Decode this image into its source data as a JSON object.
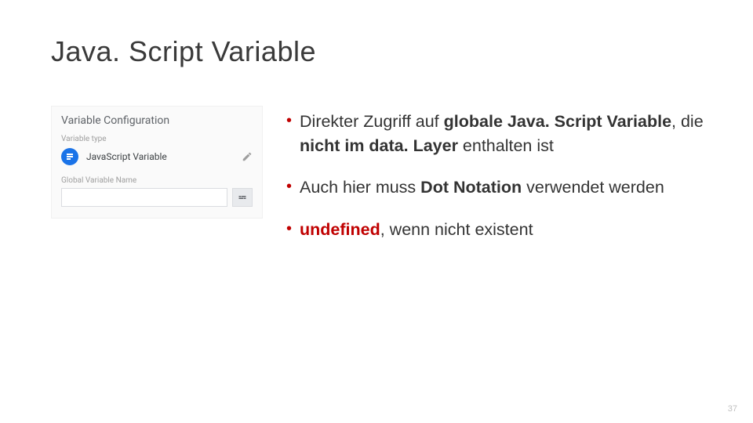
{
  "title": "Java. Script Variable",
  "panel": {
    "heading": "Variable Configuration",
    "sublabel": "Variable type",
    "type_name": "JavaScript Variable",
    "field_label": "Global Variable Name",
    "input_value": "",
    "input_placeholder": ""
  },
  "bullets": [
    {
      "segments": [
        {
          "t": "Direkter Zugriff auf "
        },
        {
          "t": "globale Java. Script Variable",
          "b": true
        },
        {
          "t": ", die "
        },
        {
          "t": "nicht im data. Layer",
          "b": true
        },
        {
          "t": " enthalten ist"
        }
      ]
    },
    {
      "segments": [
        {
          "t": "Auch hier muss "
        },
        {
          "t": "Dot Notation",
          "b": true
        },
        {
          "t": " verwendet werden"
        }
      ]
    },
    {
      "segments": [
        {
          "t": "undefined",
          "red": true
        },
        {
          "t": ", wenn nicht existent"
        }
      ]
    }
  ],
  "page_number": "37"
}
